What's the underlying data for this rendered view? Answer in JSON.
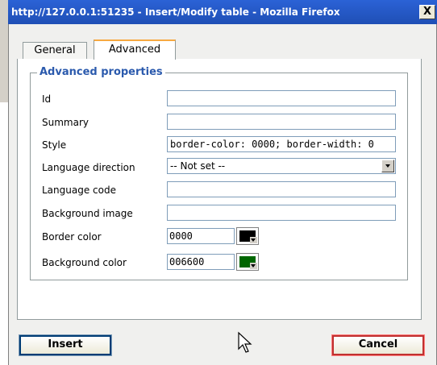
{
  "window": {
    "title": "http://127.0.0.1:51235 - Insert/Modify table - Mozilla Firefox",
    "close_label": "X"
  },
  "tabs": [
    {
      "label": "General",
      "active": false
    },
    {
      "label": "Advanced",
      "active": true
    }
  ],
  "section": {
    "legend": "Advanced properties"
  },
  "fields": {
    "id": {
      "label": "Id",
      "value": ""
    },
    "summary": {
      "label": "Summary",
      "value": ""
    },
    "style": {
      "label": "Style",
      "value": "border-color: 0000; border-width: 0"
    },
    "language_direction": {
      "label": "Language direction",
      "value": "-- Not set --"
    },
    "language_code": {
      "label": "Language code",
      "value": ""
    },
    "background_image": {
      "label": "Background image",
      "value": ""
    },
    "border_color": {
      "label": "Border color",
      "value": "0000",
      "swatch": "#000000"
    },
    "background_color": {
      "label": "Background color",
      "value": "006600",
      "swatch": "#006600"
    }
  },
  "buttons": {
    "insert": "Insert",
    "cancel": "Cancel"
  },
  "colors": {
    "titlebar": "#2458c8",
    "legend": "#2b5aad",
    "tab_accent": "#f7a941"
  }
}
